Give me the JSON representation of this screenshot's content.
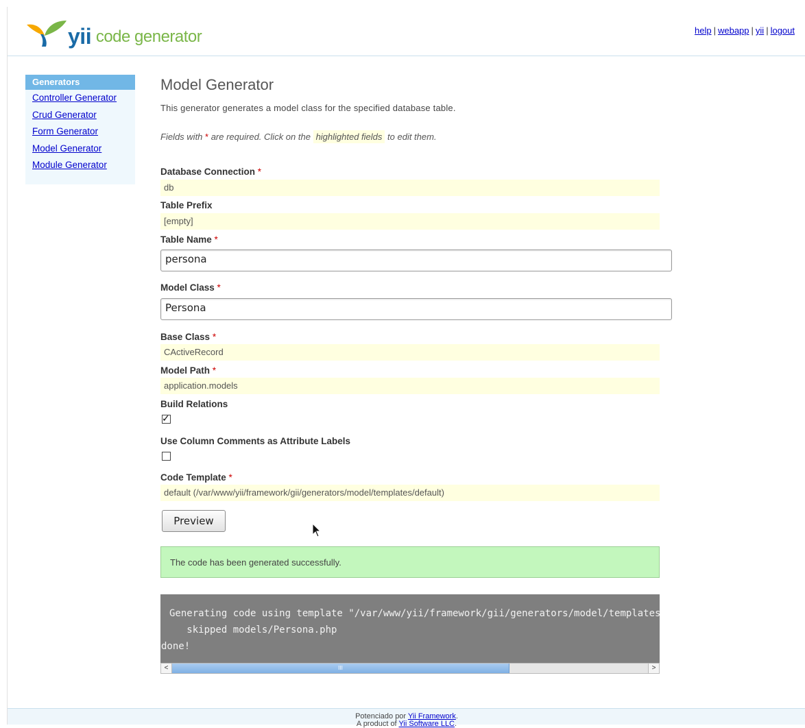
{
  "header": {
    "logo_main": "yii",
    "logo_sub": "code generator",
    "links": [
      "help",
      "webapp",
      "yii",
      "logout"
    ]
  },
  "sidebar": {
    "title": "Generators",
    "items": [
      "Controller Generator",
      "Crud Generator",
      "Form Generator",
      "Model Generator",
      "Module Generator"
    ]
  },
  "main": {
    "title": "Model Generator",
    "description": "This generator generates a model class for the specified database table.",
    "note_before": "Fields with ",
    "required_mark": "*",
    "note_mid": " are required. Click on the ",
    "note_highlight": "highlighted fields",
    "note_after": " to edit them."
  },
  "form": {
    "db_connection": {
      "label": "Database Connection",
      "value": "db"
    },
    "table_prefix": {
      "label": "Table Prefix",
      "value": "[empty]"
    },
    "table_name": {
      "label": "Table Name",
      "value": "persona"
    },
    "model_class": {
      "label": "Model Class",
      "value": "Persona"
    },
    "base_class": {
      "label": "Base Class",
      "value": "CActiveRecord"
    },
    "model_path": {
      "label": "Model Path",
      "value": "application.models"
    },
    "build_relations": {
      "label": "Build Relations",
      "checked": true
    },
    "column_comments": {
      "label": "Use Column Comments as Attribute Labels",
      "checked": false
    },
    "code_template": {
      "label": "Code Template",
      "value": "default (/var/www/yii/framework/gii/generators/model/templates/default)"
    },
    "preview_label": "Preview"
  },
  "result": {
    "success_message": "The code has been generated successfully.",
    "console_lines": [
      "Generating code using template \"/var/www/yii/framework/gii/generators/model/templates/default\"...",
      "   skipped models/Persona.php",
      "done!"
    ],
    "scroll_thumb_glyph": "III",
    "scroll_left_glyph": "<",
    "scroll_right_glyph": ">"
  },
  "footer": {
    "line1_prefix": "Potenciado por ",
    "line1_link": "Yii Framework",
    "line1_suffix": ".",
    "line2_prefix": "A product of ",
    "line2_link": "Yii Software LLC",
    "line2_suffix": "."
  },
  "colors": {
    "sidebar_header": "#71b7e6",
    "sticky_bg": "#ffffe0",
    "success_bg": "#c3f7bd",
    "console_bg": "#7f7f7f",
    "logo_blue": "#1a6ba7",
    "logo_green": "#7ab648"
  }
}
